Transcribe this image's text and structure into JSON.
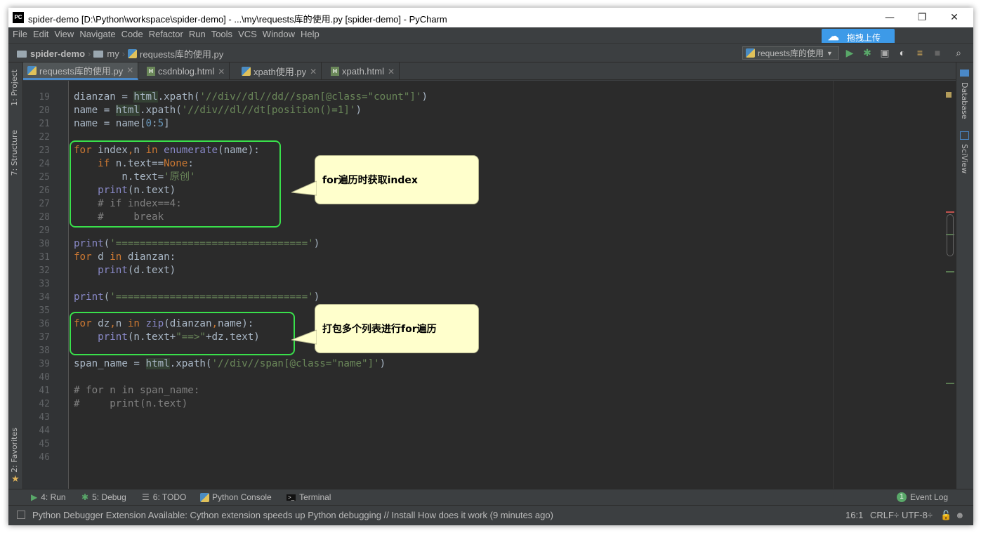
{
  "window": {
    "title": "spider-demo [D:\\Python\\workspace\\spider-demo] - ...\\my\\requests库的使用.py [spider-demo] - PyCharm",
    "app_icon": "PC",
    "minimize": "—",
    "restore": "❐",
    "close": "✕"
  },
  "menu": [
    "File",
    "Edit",
    "View",
    "Navigate",
    "Code",
    "Refactor",
    "Run",
    "Tools",
    "VCS",
    "Window",
    "Help"
  ],
  "upload_button": "拖拽上传",
  "breadcrumb": {
    "project": "spider-demo",
    "folder": "my",
    "file": "requests库的使用.py"
  },
  "run_config": "requests库的使用",
  "tabs": [
    {
      "label": "requests库的使用.py",
      "active": true,
      "type": "py"
    },
    {
      "label": "csdnblog.html",
      "active": false,
      "type": "html"
    },
    {
      "label": "xpath使用.py",
      "active": false,
      "type": "py"
    },
    {
      "label": "xpath.html",
      "active": false,
      "type": "html"
    }
  ],
  "left_tools": {
    "project": "1: Project",
    "structure": "7: Structure",
    "favorites": "2: Favorites"
  },
  "right_tools": {
    "database": "Database",
    "sciview": "SciView"
  },
  "line_numbers": [
    "19",
    "20",
    "21",
    "22",
    "23",
    "24",
    "25",
    "26",
    "27",
    "28",
    "29",
    "30",
    "31",
    "32",
    "33",
    "34",
    "35",
    "36",
    "37",
    "38",
    "39",
    "40",
    "41",
    "42",
    "43",
    "44",
    "45",
    "46"
  ],
  "code_lines": [
    "dianzan = html.xpath('//div//dl//dd//span[@class=\"count\"]')",
    "name = html.xpath('//div//dl//dt[position()=1]')",
    "name = name[0:5]",
    "",
    "for index,n in enumerate(name):",
    "    if n.text==None:",
    "        n.text='原创'",
    "    print(n.text)",
    "    # if index==4:",
    "    #     break",
    "",
    "print('================================')",
    "for d in dianzan:",
    "    print(d.text)",
    "",
    "print('================================')",
    "",
    "for dz,n in zip(dianzan,name):",
    "    print(n.text+\"==>\"+dz.text)",
    "",
    "span_name = html.xpath('//div//span[@class=\"name\"]')",
    "",
    "# for n in span_name:",
    "#     print(n.text)",
    "",
    "",
    "",
    ""
  ],
  "annotations": {
    "callout1": "for遍历时获取index",
    "callout2": "打包多个列表进行for遍历"
  },
  "bottom_tools": [
    {
      "label": "4: Run",
      "icon": "run-icon"
    },
    {
      "label": "5: Debug",
      "icon": "debug-icon"
    },
    {
      "label": "6: TODO",
      "icon": "todo-icon"
    },
    {
      "label": "Python Console",
      "icon": "python-console-icon"
    },
    {
      "label": "Terminal",
      "icon": "terminal-icon"
    }
  ],
  "event_log": {
    "label": "Event Log",
    "count": "1"
  },
  "status": {
    "message": "Python Debugger Extension Available: Cython extension speeds up Python debugging // Install How does it work (9 minutes ago)",
    "position": "16:1",
    "line_sep": "CRLF÷",
    "encoding": "UTF-8÷"
  },
  "colors": {
    "keyword": "#cc7832",
    "string": "#6a8759",
    "number": "#6897bb",
    "comment": "#808080",
    "builtin": "#8888c6",
    "highlight_box": "#39e04b",
    "callout_bg": "#ffffcc",
    "upload_bg": "#3d9ae8"
  }
}
